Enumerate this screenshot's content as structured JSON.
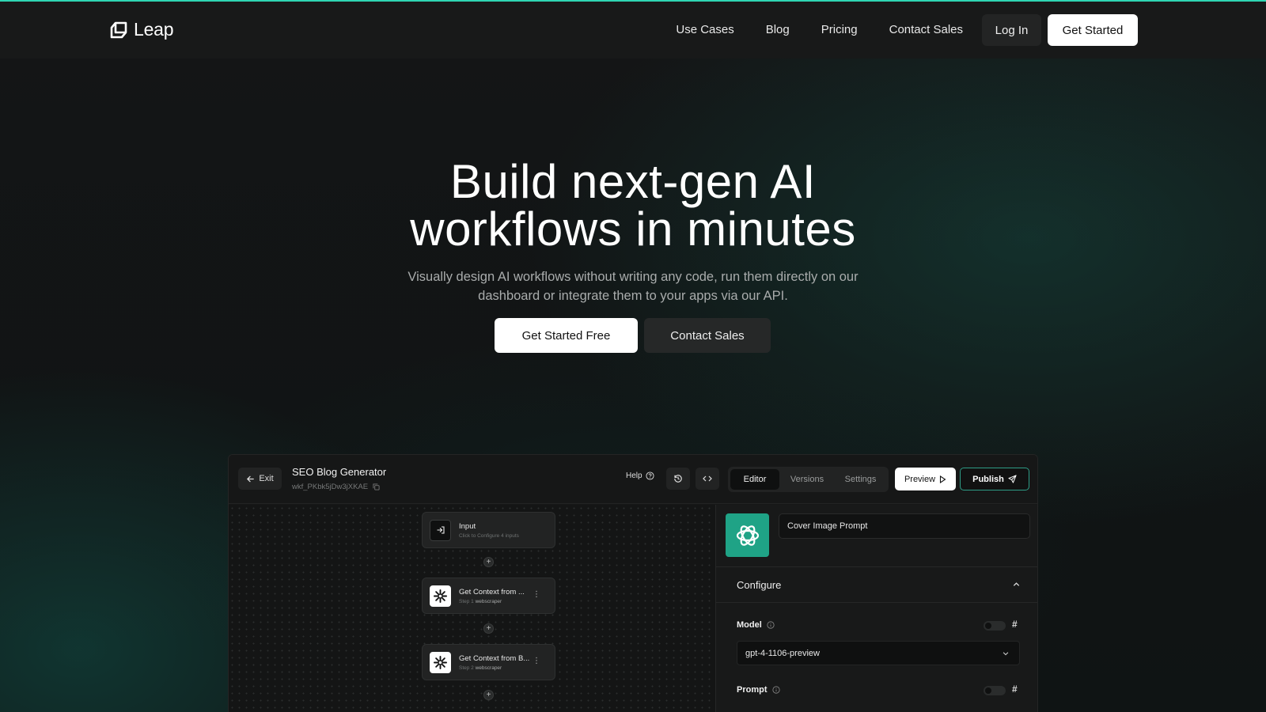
{
  "nav": {
    "logo_text": "Leap",
    "links": [
      "Use Cases",
      "Blog",
      "Pricing",
      "Contact Sales"
    ],
    "login_label": "Log In",
    "get_started_label": "Get Started"
  },
  "hero": {
    "title_line1": "Build next-gen AI",
    "title_line2": "workflows in minutes",
    "subtitle": "Visually design AI workflows without writing any code, run them directly on our dashboard or integrate them to your apps via our API.",
    "cta_primary": "Get Started Free",
    "cta_secondary": "Contact Sales"
  },
  "app": {
    "exit_label": "Exit",
    "workflow_title": "SEO Blog Generator",
    "workflow_id": "wkf_PKbk5jDw3jXKAE",
    "help_label": "Help",
    "tabs": [
      "Editor",
      "Versions",
      "Settings"
    ],
    "active_tab": "Editor",
    "preview_label": "Preview",
    "publish_label": "Publish",
    "nodes": [
      {
        "title": "Input",
        "sub": "Click to Configure 4 inputs",
        "tag": ""
      },
      {
        "title": "Get Context from ...",
        "sub": "Step 1",
        "tag": "webscraper"
      },
      {
        "title": "Get Context from B...",
        "sub": "Step 2",
        "tag": "webscraper"
      }
    ],
    "panel": {
      "step_name": "Cover Image Prompt",
      "configure_label": "Configure",
      "model_label": "Model",
      "model_value": "gpt-4-1106-preview",
      "prompt_label": "Prompt",
      "hash": "#"
    }
  },
  "colors": {
    "accent": "#2fd6b3",
    "openai_green": "#1fa386"
  }
}
